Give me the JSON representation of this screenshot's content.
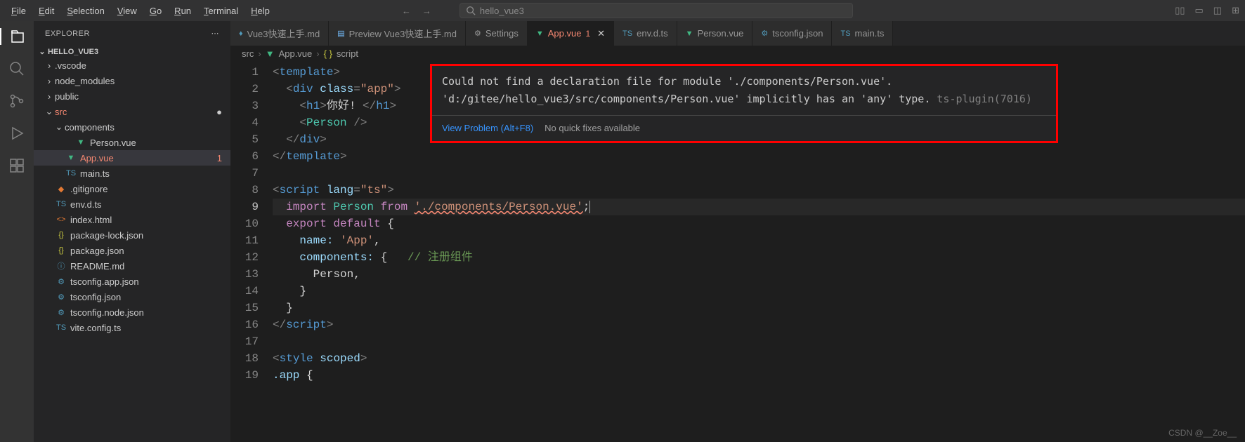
{
  "menu": [
    "File",
    "Edit",
    "Selection",
    "View",
    "Go",
    "Run",
    "Terminal",
    "Help"
  ],
  "search": {
    "placeholder": "hello_vue3"
  },
  "sidebar": {
    "title": "EXPLORER",
    "project": "HELLO_VUE3",
    "tree": [
      {
        "type": "folder",
        "name": ".vscode",
        "depth": 1,
        "open": false
      },
      {
        "type": "folder",
        "name": "node_modules",
        "depth": 1,
        "open": false
      },
      {
        "type": "folder",
        "name": "public",
        "depth": 1,
        "open": false
      },
      {
        "type": "folder",
        "name": "src",
        "depth": 1,
        "open": true,
        "error": true,
        "dot": true
      },
      {
        "type": "folder",
        "name": "components",
        "depth": 2,
        "open": true
      },
      {
        "type": "file",
        "name": "Person.vue",
        "depth": 3,
        "icon": "vue"
      },
      {
        "type": "file",
        "name": "App.vue",
        "depth": 2,
        "icon": "vue",
        "error": true,
        "selected": true,
        "badge": "1"
      },
      {
        "type": "file",
        "name": "main.ts",
        "depth": 2,
        "icon": "ts"
      },
      {
        "type": "file",
        "name": ".gitignore",
        "depth": 1,
        "icon": "git"
      },
      {
        "type": "file",
        "name": "env.d.ts",
        "depth": 1,
        "icon": "ts"
      },
      {
        "type": "file",
        "name": "index.html",
        "depth": 1,
        "icon": "html"
      },
      {
        "type": "file",
        "name": "package-lock.json",
        "depth": 1,
        "icon": "json"
      },
      {
        "type": "file",
        "name": "package.json",
        "depth": 1,
        "icon": "json"
      },
      {
        "type": "file",
        "name": "README.md",
        "depth": 1,
        "icon": "info"
      },
      {
        "type": "file",
        "name": "tsconfig.app.json",
        "depth": 1,
        "icon": "cfg"
      },
      {
        "type": "file",
        "name": "tsconfig.json",
        "depth": 1,
        "icon": "cfg"
      },
      {
        "type": "file",
        "name": "tsconfig.node.json",
        "depth": 1,
        "icon": "cfg"
      },
      {
        "type": "file",
        "name": "vite.config.ts",
        "depth": 1,
        "icon": "ts"
      }
    ]
  },
  "tabs": [
    {
      "label": "Vue3快速上手.md",
      "icon": "md"
    },
    {
      "label": "Preview Vue3快速上手.md",
      "icon": "preview"
    },
    {
      "label": "Settings",
      "icon": "gear"
    },
    {
      "label": "App.vue",
      "icon": "vue",
      "active": true,
      "error": true,
      "badge": "1",
      "close": true
    },
    {
      "label": "env.d.ts",
      "icon": "ts"
    },
    {
      "label": "Person.vue",
      "icon": "vue"
    },
    {
      "label": "tsconfig.json",
      "icon": "cfg"
    },
    {
      "label": "main.ts",
      "icon": "ts"
    }
  ],
  "breadcrumb": {
    "p1": "src",
    "p2": "App.vue",
    "p3": "script",
    "icon2": "vue",
    "icon3": "braces"
  },
  "hover": {
    "msg_l1": "Could not find a declaration file for module './components/Person.vue'.",
    "msg_l2": "'d:/gitee/hello_vue3/src/components/Person.vue' implicitly has an 'any' type.",
    "msg_code": " ts-plugin(7016)",
    "action1": "View Problem (Alt+F8)",
    "action2": "No quick fixes available"
  },
  "code": {
    "lines": [
      "1",
      "2",
      "3",
      "4",
      "5",
      "6",
      "7",
      "8",
      "9",
      "10",
      "11",
      "12",
      "13",
      "14",
      "15",
      "16",
      "17",
      "18",
      "19"
    ],
    "l3_text": "你好! ",
    "l9_path": "'./components/Person.vue'",
    "l11_name": "name: ",
    "l11_val": "'App'",
    "l12_prop": "components: ",
    "l12_comment": "// 注册组件",
    "l13_val": "Person,"
  },
  "watermark": "CSDN @__Zoe__"
}
